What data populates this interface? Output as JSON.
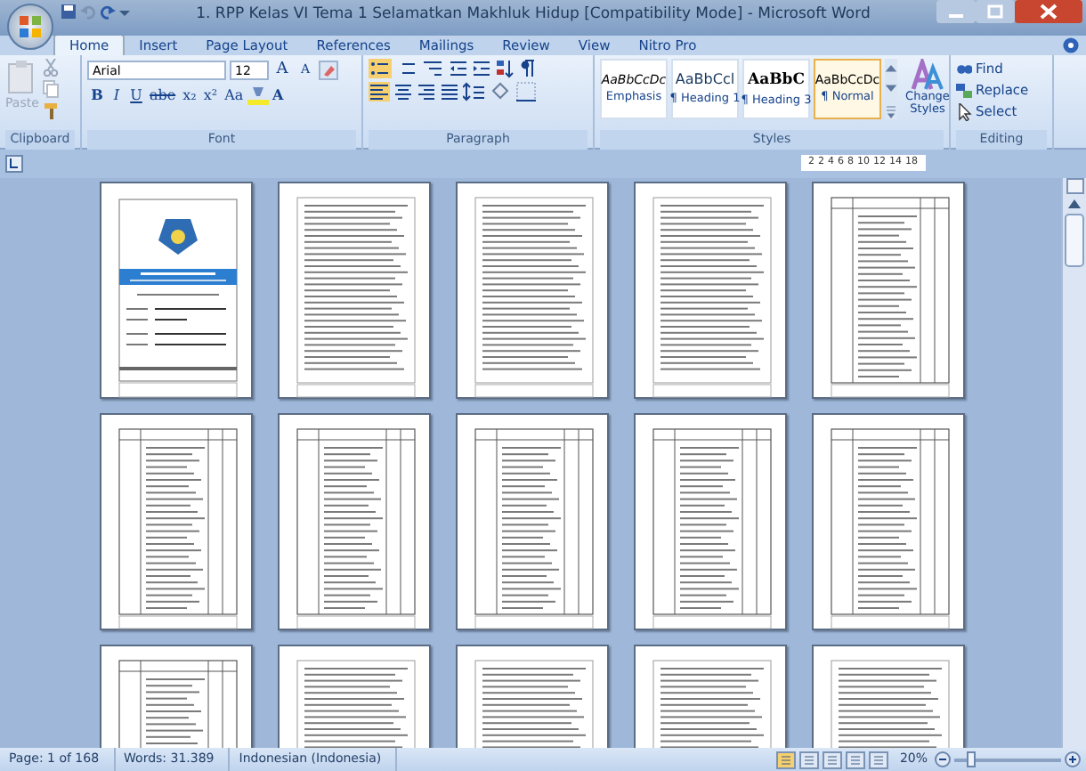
{
  "window": {
    "title": "1. RPP Kelas VI Tema 1 Selamatkan Makhluk Hidup [Compatibility Mode] - Microsoft Word"
  },
  "tabs": [
    {
      "label": "Home",
      "selected": true
    },
    {
      "label": "Insert",
      "selected": false
    },
    {
      "label": "Page Layout",
      "selected": false
    },
    {
      "label": "References",
      "selected": false
    },
    {
      "label": "Mailings",
      "selected": false
    },
    {
      "label": "Review",
      "selected": false
    },
    {
      "label": "View",
      "selected": false
    },
    {
      "label": "Nitro Pro",
      "selected": false
    }
  ],
  "ribbon": {
    "clipboard": {
      "paste": "Paste",
      "label": "Clipboard"
    },
    "font": {
      "name": "Arial",
      "size": "12",
      "grow": "A",
      "shrink": "A",
      "format_buttons": [
        "B",
        "I",
        "U",
        "abe",
        "x₂",
        "x²",
        "Aa"
      ],
      "font_color": "A",
      "label": "Font"
    },
    "paragraph": {
      "label": "Paragraph"
    },
    "styles": {
      "items": [
        {
          "kind": "emphasis",
          "preview": "AaBbCcDc",
          "name": "Emphasis",
          "selected": false
        },
        {
          "kind": "heading1",
          "preview": "AaBbCcl",
          "name": "¶ Heading 1",
          "selected": false
        },
        {
          "kind": "heading3",
          "preview": "AaBbC",
          "name": "¶ Heading 3",
          "selected": false
        },
        {
          "kind": "normal",
          "preview": "AaBbCcDc",
          "name": "¶ Normal",
          "selected": true
        }
      ],
      "change_styles": "Change Styles",
      "label": "Styles"
    },
    "editing": {
      "buttons": [
        "Find",
        "Replace",
        "Select"
      ],
      "label": "Editing"
    }
  },
  "ruler": {
    "numbers": [
      "2",
      "2",
      "4",
      "6",
      "8",
      "10",
      "12",
      "14",
      "18"
    ]
  },
  "pages": [
    {
      "kind": "cover"
    },
    {
      "kind": "text"
    },
    {
      "kind": "text"
    },
    {
      "kind": "text"
    },
    {
      "kind": "table"
    },
    {
      "kind": "table"
    },
    {
      "kind": "table"
    },
    {
      "kind": "table"
    },
    {
      "kind": "table"
    },
    {
      "kind": "table"
    },
    {
      "kind": "table"
    },
    {
      "kind": "text"
    },
    {
      "kind": "text"
    },
    {
      "kind": "text"
    },
    {
      "kind": "text"
    }
  ],
  "status_bar": {
    "page": "Page: 1 of 168",
    "words": "Words: 31.389",
    "language": "Indonesian (Indonesia)",
    "zoom": "20%",
    "zoom_slider": {
      "level": 0.12
    }
  }
}
